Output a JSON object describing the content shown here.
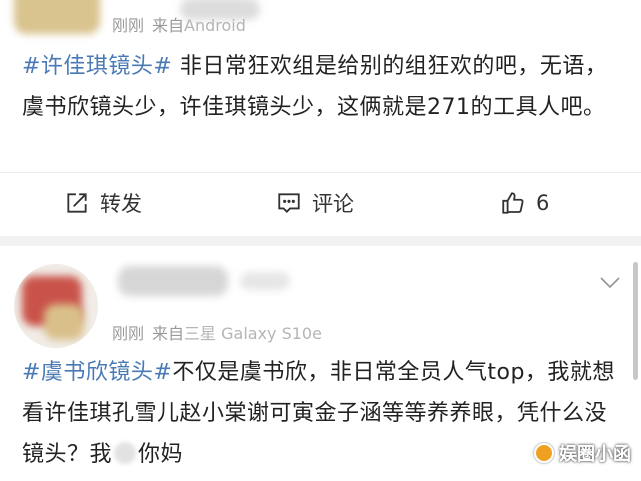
{
  "post1": {
    "time": "刚刚",
    "source": "来自",
    "device": "Android",
    "hashtag": "#许佳琪镜头#",
    "body": " 非日常狂欢组是给别的组狂欢的吧，无语， 虞书欣镜头少，许佳琪镜头少，这俩就是271的工具人吧。",
    "actions": {
      "repost_label": "转发",
      "comment_label": "评论",
      "like_count": "6"
    }
  },
  "post2": {
    "time": "刚刚",
    "source": "来自",
    "device": "三星 Galaxy S10e",
    "hashtag": "#虞书欣镜头#",
    "body_a": "不仅是虞书欣，非日常全员人气top，我就想看许佳琪孔雪儿赵小棠谢可寅金子涵等等养养眼，凭什么没镜头？我",
    "body_b": "你妈"
  },
  "watermark": "娱圈小函",
  "colors": {
    "hashtag": "#4a7ab5",
    "separator": "#f2f2f2",
    "meta": "#9a9a9a"
  }
}
